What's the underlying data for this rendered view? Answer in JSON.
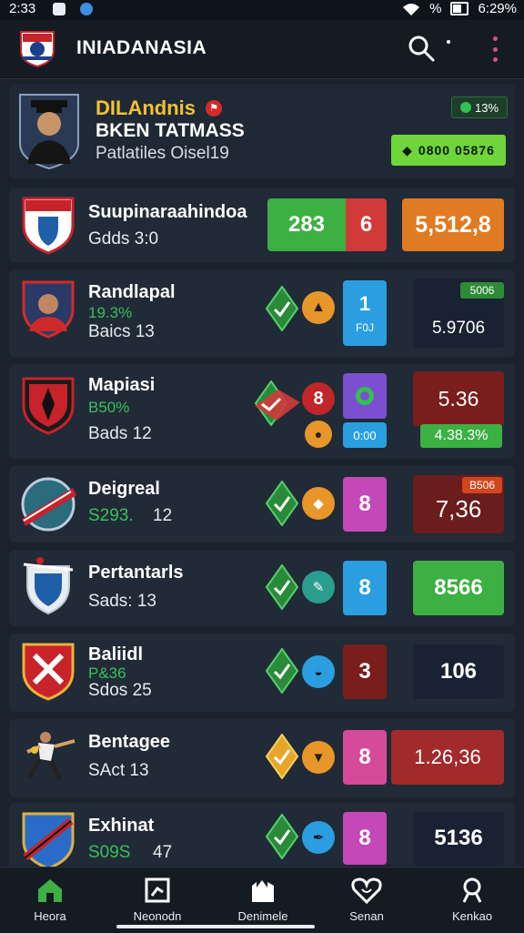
{
  "status_bar": {
    "time": "2:33",
    "battery_pct": "%",
    "signal_text": "6:29%"
  },
  "app_bar": {
    "title": "INIADANASIA"
  },
  "profile": {
    "name": "DILAndnis",
    "team": "BKEN TATMASS",
    "subtitle": "Patlatiles Oisel19",
    "badge": "13%",
    "code": "0800 05876"
  },
  "teams": [
    {
      "name": "Suupinaraahindoa",
      "stat": "Gdds 3:0",
      "score_a": "283",
      "score_b": "6",
      "value": "5,512,8",
      "colors": {
        "score_a": "#3cb043",
        "score_b": "#d23a3a",
        "value": "#e07b22"
      }
    },
    {
      "name": "Randlapal",
      "pct": "19.3%",
      "stat": "Baics 13",
      "tile_top": "1",
      "tile_bottom": "F0J",
      "tag": "5006",
      "value": "5.9706"
    },
    {
      "name": "Mapiasi",
      "pct": "B50%",
      "stat": "Bads 12",
      "circle_badge": "8",
      "tile_bottom": "0:00",
      "value": "5.36",
      "tag": "4.38.3%"
    },
    {
      "name": "Deigreal",
      "pct": "S293.",
      "stat": "12",
      "tile": "8",
      "tag": "B506",
      "value": "7,36"
    },
    {
      "name": "Pertantarls",
      "stat": "Sads: 13",
      "tile": "8",
      "value": "8566"
    },
    {
      "name": "Baliidl",
      "pct": "P&36",
      "stat": "Sdos 25",
      "tile": "3",
      "value": "106"
    },
    {
      "name": "Bentagee",
      "stat": "SAct 13",
      "tile": "8",
      "value": "1.26,36"
    },
    {
      "name": "Exhinat",
      "pct": "S09S",
      "stat": "47",
      "tile": "8",
      "value": "5136"
    }
  ],
  "bottom_nav": [
    {
      "label": "Heora",
      "icon": "house-icon"
    },
    {
      "label": "Neonodn",
      "icon": "chart-box-icon"
    },
    {
      "label": "Denimele",
      "icon": "castle-icon"
    },
    {
      "label": "Senan",
      "icon": "heart-icon"
    },
    {
      "label": "Kenkao",
      "icon": "trophy-icon"
    }
  ]
}
